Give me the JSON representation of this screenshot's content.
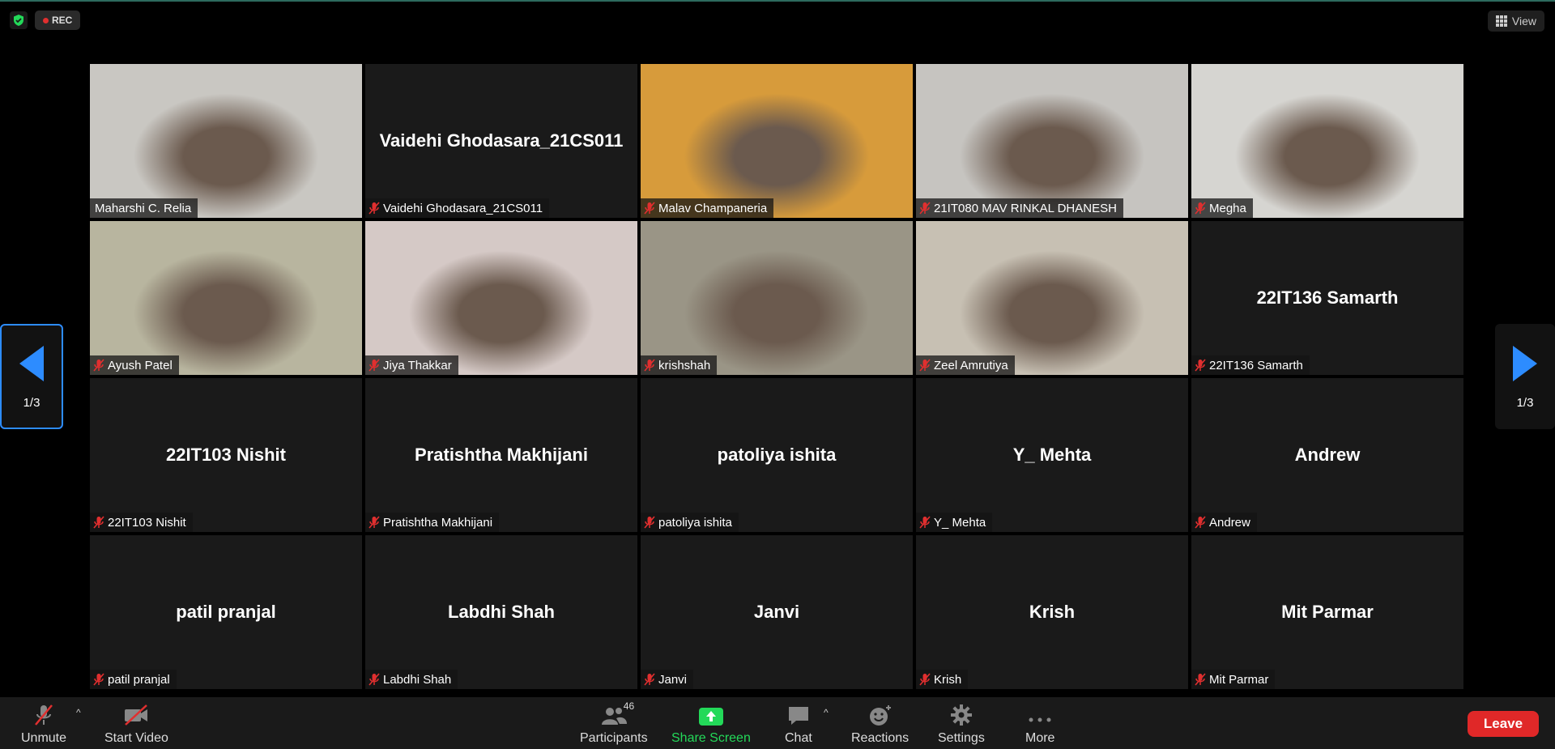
{
  "top": {
    "rec_label": "REC",
    "view_label": "View"
  },
  "tiles": [
    {
      "name": "Maharshi C. Relia",
      "label": "Maharshi C. Relia",
      "video": true,
      "muted": false,
      "active": true,
      "bg": "#c9c7c2"
    },
    {
      "name": "Vaidehi Ghodasara_21CS011",
      "label": "Vaidehi Ghodasara_21CS011",
      "video": false,
      "muted": true
    },
    {
      "name": "Malav Champaneria",
      "label": "Malav Champaneria",
      "video": true,
      "muted": true,
      "bg": "#d79b3b"
    },
    {
      "name": "21IT080 MAV RINKAL DHANESH",
      "label": "21IT080 MAV RINKAL DHANESH",
      "video": true,
      "muted": true,
      "bg": "#c6c4c0"
    },
    {
      "name": "Megha",
      "label": "Megha",
      "video": true,
      "muted": true,
      "bg": "#d6d5d1"
    },
    {
      "name": "Ayush Patel",
      "label": "Ayush Patel",
      "video": true,
      "muted": true,
      "bg": "#b8b59f"
    },
    {
      "name": "Jiya Thakkar",
      "label": "Jiya Thakkar",
      "video": true,
      "muted": true,
      "bg": "#d5c9c6"
    },
    {
      "name": "krishshah",
      "label": "krishshah",
      "video": true,
      "muted": true,
      "bg": "#9a9586"
    },
    {
      "name": "Zeel Amrutiya",
      "label": "Zeel Amrutiya",
      "video": true,
      "muted": true,
      "bg": "#c7c0b3"
    },
    {
      "name": "22IT136 Samarth",
      "label": "22IT136 Samarth",
      "video": false,
      "muted": true
    },
    {
      "name": "22IT103 Nishit",
      "label": "22IT103 Nishit",
      "video": false,
      "muted": true
    },
    {
      "name": "Pratishtha Makhijani",
      "label": "Pratishtha Makhijani",
      "video": false,
      "muted": true
    },
    {
      "name": "patoliya ishita",
      "label": "patoliya ishita",
      "video": false,
      "muted": true
    },
    {
      "name": "Y_ Mehta",
      "label": "Y_ Mehta",
      "video": false,
      "muted": true
    },
    {
      "name": "Andrew",
      "label": "Andrew",
      "video": false,
      "muted": true
    },
    {
      "name": "patil pranjal",
      "label": "patil pranjal",
      "video": false,
      "muted": true
    },
    {
      "name": "Labdhi Shah",
      "label": "Labdhi Shah",
      "video": false,
      "muted": true
    },
    {
      "name": "Janvi",
      "label": "Janvi",
      "video": false,
      "muted": true
    },
    {
      "name": "Krish",
      "label": "Krish",
      "video": false,
      "muted": true
    },
    {
      "name": "Mit Parmar",
      "label": "Mit Parmar",
      "video": false,
      "muted": true
    }
  ],
  "pager": {
    "left": "1/3",
    "right": "1/3"
  },
  "toolbar": {
    "unmute": "Unmute",
    "start_video": "Start Video",
    "participants": "Participants",
    "participants_count": "46",
    "share_screen": "Share Screen",
    "chat": "Chat",
    "reactions": "Reactions",
    "settings": "Settings",
    "more": "More",
    "leave": "Leave"
  },
  "colors": {
    "accent_blue": "#2d8cff",
    "leave_red": "#e02828",
    "share_green": "#23d959",
    "muted_red": "#e02f2f",
    "active_border": "#c8e07a"
  }
}
